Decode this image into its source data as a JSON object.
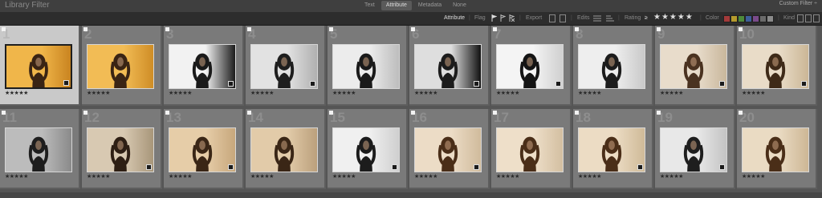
{
  "app": {
    "title": "Library Filter",
    "filter_tabs": [
      "Text",
      "Attribute",
      "Metadata",
      "None"
    ],
    "active_tab": "Attribute",
    "custom_filter": "Custom Filter ÷"
  },
  "attribute_bar": {
    "attribute_label": "Attribute",
    "flag_label": "Flag",
    "export_label": "Export",
    "edits_label": "Edits",
    "rating_label": "Rating",
    "rating_operator": "≥",
    "rating_stars": "★★★★★",
    "color_label": "Color",
    "kind_label": "Kind",
    "color_swatches": [
      "#a33a3a",
      "#b59a2c",
      "#4d8a3a",
      "#3e5e9a",
      "#7a4a8a",
      "#6a6a6a",
      "#8a8a8a"
    ]
  },
  "grid": {
    "cells": [
      {
        "num": "1",
        "rating": "★★★★★",
        "bg": "#f0b64a",
        "bg2": "#c98420",
        "subject": "#3a2414",
        "selected": true
      },
      {
        "num": "2",
        "rating": "★★★★★",
        "bg": "#f2bc55",
        "bg2": "#cf8d26",
        "subject": "#3a2414",
        "selected": false
      },
      {
        "num": "3",
        "rating": "★★★★★",
        "bg": "#f2f2f2",
        "bg2": "#1c1c1c",
        "subject": "#1a1a1a",
        "selected": false
      },
      {
        "num": "4",
        "rating": "★★★★★",
        "bg": "#e2e2e2",
        "bg2": "#b0b0b0",
        "subject": "#1e1e1e",
        "selected": false
      },
      {
        "num": "5",
        "rating": "★★★★★",
        "bg": "#ececec",
        "bg2": "#bdbdbd",
        "subject": "#1a1a1a",
        "selected": false
      },
      {
        "num": "6",
        "rating": "★★★★★",
        "bg": "#dedede",
        "bg2": "#111111",
        "subject": "#1c1c1c",
        "selected": false
      },
      {
        "num": "7",
        "rating": "★★★★★",
        "bg": "#f4f4f4",
        "bg2": "#d0d0d0",
        "subject": "#141414",
        "selected": false
      },
      {
        "num": "8",
        "rating": "★★★★★",
        "bg": "#eeeeee",
        "bg2": "#c9c9c9",
        "subject": "#1c1c1c",
        "selected": false
      },
      {
        "num": "9",
        "rating": "★★★★★",
        "bg": "#e8dccb",
        "bg2": "#c9b79c",
        "subject": "#4a3220",
        "selected": false
      },
      {
        "num": "10",
        "rating": "★★★★★",
        "bg": "#e9dcc8",
        "bg2": "#cbb796",
        "subject": "#3e2a18",
        "selected": false
      },
      {
        "num": "11",
        "rating": "★★★★★",
        "bg": "#bcbcbc",
        "bg2": "#8a8a8a",
        "subject": "#1e1e1e",
        "selected": false
      },
      {
        "num": "12",
        "rating": "★★★★★",
        "bg": "#d8c9b2",
        "bg2": "#a8967a",
        "subject": "#2e1f14",
        "selected": false
      },
      {
        "num": "13",
        "rating": "★★★★★",
        "bg": "#e6cda8",
        "bg2": "#c7a77c",
        "subject": "#3a2616",
        "selected": false
      },
      {
        "num": "14",
        "rating": "★★★★★",
        "bg": "#e2cba9",
        "bg2": "#bba07c",
        "subject": "#3a2616",
        "selected": false
      },
      {
        "num": "15",
        "rating": "★★★★★",
        "bg": "#f0f0f0",
        "bg2": "#cfcfcf",
        "subject": "#1c1c1c",
        "selected": false
      },
      {
        "num": "16",
        "rating": "★★★★★",
        "bg": "#ecdcc6",
        "bg2": "#d0bb9c",
        "subject": "#4a2e18",
        "selected": false
      },
      {
        "num": "17",
        "rating": "★★★★★",
        "bg": "#eedfc9",
        "bg2": "#d3bfa1",
        "subject": "#4a2e18",
        "selected": false
      },
      {
        "num": "18",
        "rating": "★★★★★",
        "bg": "#ecdcc4",
        "bg2": "#cfba98",
        "subject": "#4a2e18",
        "selected": false
      },
      {
        "num": "19",
        "rating": "★★★★★",
        "bg": "#e8e8e8",
        "bg2": "#c4c4c4",
        "subject": "#1e1e1e",
        "selected": false
      },
      {
        "num": "20",
        "rating": "★★★★★",
        "bg": "#eadbc3",
        "bg2": "#cdb795",
        "subject": "#4a2e18",
        "selected": false
      }
    ]
  }
}
